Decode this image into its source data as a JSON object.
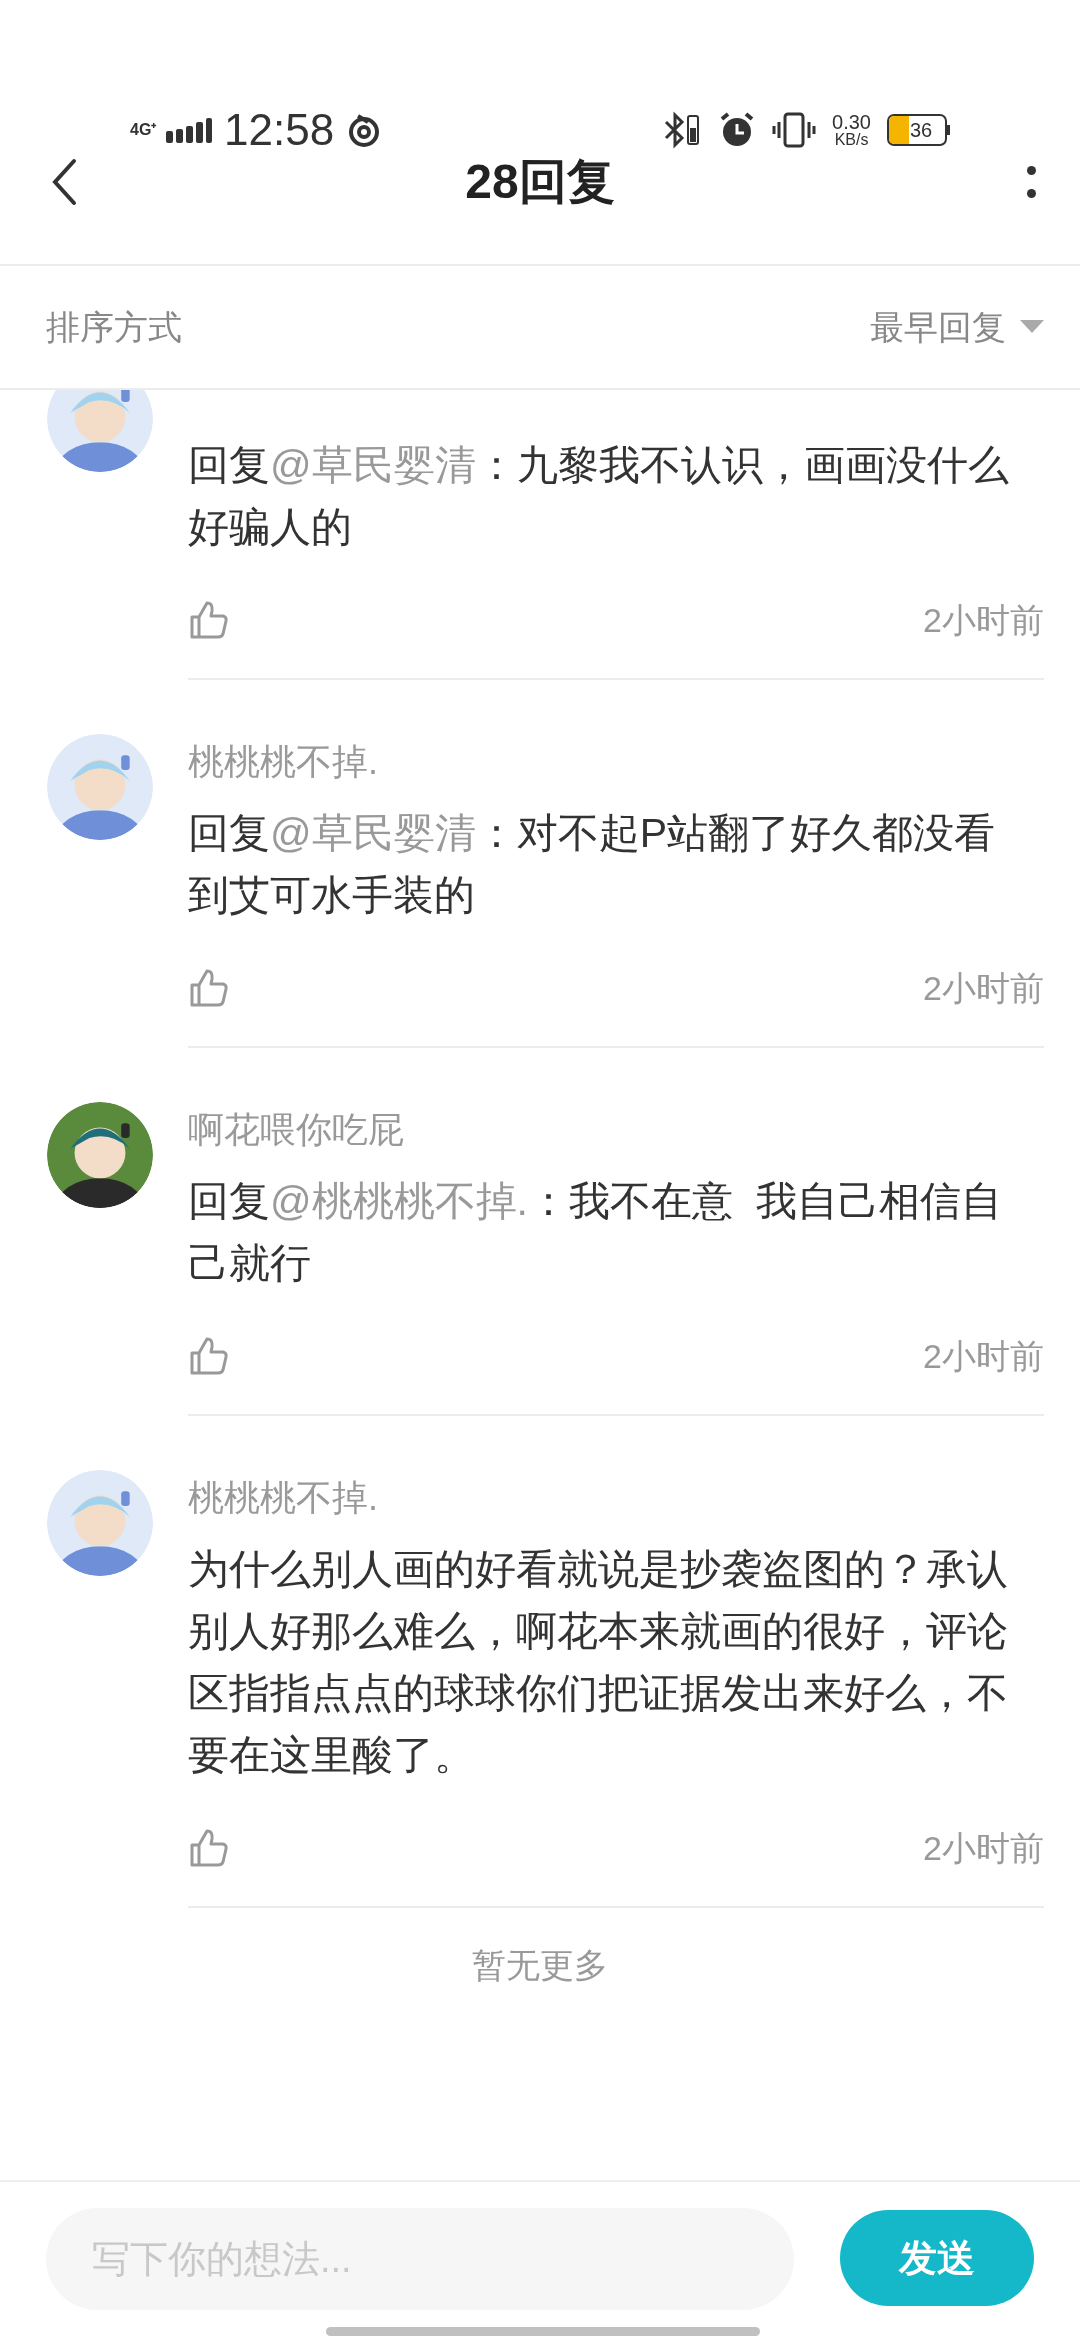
{
  "status_bar": {
    "network": "4G⁺",
    "time": "12:58",
    "speed_value": "0.30",
    "speed_unit": "KB/s",
    "battery": "36"
  },
  "header": {
    "title": "28回复"
  },
  "sort_bar": {
    "label": "排序方式",
    "value": "最早回复"
  },
  "comments": [
    {
      "prefix": "回复",
      "mention": "@草民婴清",
      "text": "：九黎我不认识，画画没什么好骗人的",
      "time": "2小时前",
      "liked": false
    },
    {
      "name": "桃桃桃不掉.",
      "prefix": "回复",
      "mention": "@草民婴清",
      "text": "：对不起P站翻了好久都没看到艾可水手装的",
      "time": "2小时前",
      "liked": false
    },
    {
      "name": "啊花喂你吃屁",
      "prefix": "回复",
      "mention": "@桃桃桃不掉.",
      "text": "：我不在意  我自己相信自己就行",
      "time": "2小时前",
      "liked": false
    },
    {
      "name": "桃桃桃不掉.",
      "text": "为什么别人画的好看就说是抄袭盗图的？承认别人好那么难么，啊花本来就画的很好，评论区指指点点的球球你们把证据发出来好么，不要在这里酸了。",
      "time": "2小时前",
      "liked": false
    }
  ],
  "end_note": "暂无更多",
  "composer": {
    "placeholder": "写下你的想法...",
    "send": "发送"
  }
}
